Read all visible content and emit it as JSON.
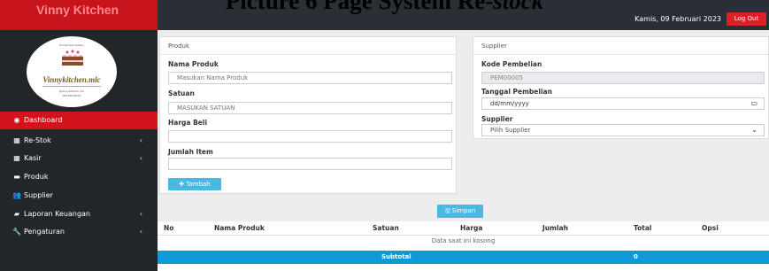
{
  "caption": {
    "main": "Picture 6 Page System Re-",
    "italic": "stock"
  },
  "brand": {
    "name": "Vinny Kitchen"
  },
  "header": {
    "date": "Kamis, 09 Februari 2023",
    "logout_label": "Log Out"
  },
  "logo": {
    "top_text": "homemade bakery",
    "script": "Vinnykitchen.mlc",
    "line1": "@vinnykitchen.mlc",
    "line2": "08178978737"
  },
  "sidebar": {
    "items": [
      {
        "label": "Dashboard",
        "icon": "dashboard-icon",
        "glyph": "◉",
        "active": true,
        "chevron": ""
      },
      {
        "label": "Re-Stok",
        "icon": "grid-icon",
        "glyph": "▦",
        "active": false,
        "chevron": "‹"
      },
      {
        "label": "Kasir",
        "icon": "grid-icon",
        "glyph": "▦",
        "active": false,
        "chevron": "‹"
      },
      {
        "label": "Produk",
        "icon": "list-icon",
        "glyph": "▬",
        "active": false,
        "chevron": ""
      },
      {
        "label": "Supplier",
        "icon": "users-icon",
        "glyph": "👥",
        "active": false,
        "chevron": ""
      },
      {
        "label": "Laporan Keuangan",
        "icon": "book-icon",
        "glyph": "▰",
        "active": false,
        "chevron": "‹"
      },
      {
        "label": "Pengaturan",
        "icon": "wrench-icon",
        "glyph": "🔧",
        "active": false,
        "chevron": "‹"
      }
    ]
  },
  "produk_panel": {
    "title": "Produk",
    "nama_label": "Nama Produk",
    "nama_placeholder": "Masukan Nama Produk",
    "satuan_label": "Satuan",
    "satuan_placeholder": "MASUKAN SATUAN",
    "harga_label": "Harga Beli",
    "harga_value": "",
    "jumlah_label": "Jumlah Item",
    "jumlah_value": "",
    "tambah_label": "✚ Tambah"
  },
  "supplier_panel": {
    "title": "Supplier",
    "kode_label": "Kode Pembelian",
    "kode_value": "PEM00005",
    "tanggal_label": "Tanggal Pembelian",
    "tanggal_placeholder": "dd/mm/yyyy",
    "supplier_label": "Supplier",
    "supplier_selected": "Pilih Supplier"
  },
  "simpan_label": "🖫 Simpan",
  "table": {
    "columns": [
      "No",
      "Nama Produk",
      "Satuan",
      "Harga",
      "Jumlah",
      "Total",
      "Opsi"
    ],
    "empty_text": "Data saat ini kosong",
    "subtotal_label": "Subtotal",
    "subtotal_value": "0"
  },
  "colors": {
    "brand_red": "#c7131b",
    "active_red": "#d3131b",
    "sidebar_bg": "#232629",
    "topbar_bg": "#2a2f35",
    "accent_blue": "#4ab9e2",
    "subtotal_blue": "#0d9ad6"
  }
}
